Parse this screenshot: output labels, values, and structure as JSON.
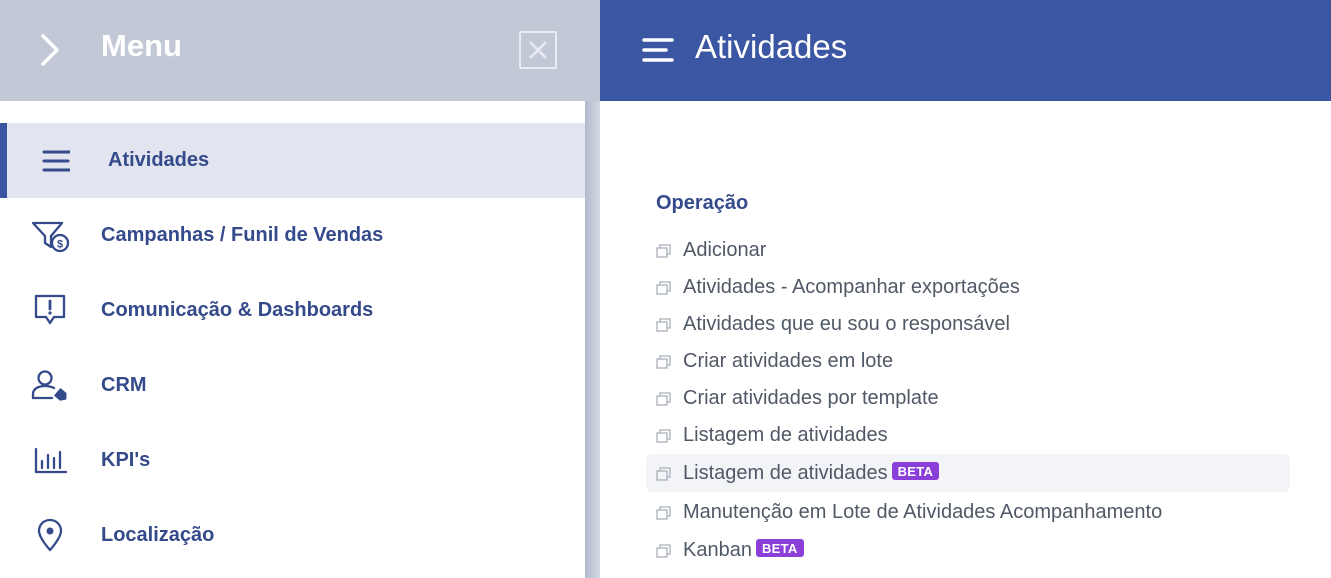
{
  "menu": {
    "title": "Menu",
    "items": [
      {
        "label": "Atividades",
        "icon": "list-lines-icon",
        "active": true
      },
      {
        "label": "Campanhas / Funil de Vendas",
        "icon": "funnel-dollar-icon"
      },
      {
        "label": "Comunicação & Dashboards",
        "icon": "message-alert-icon"
      },
      {
        "label": "CRM",
        "icon": "user-tag-icon"
      },
      {
        "label": "KPI's",
        "icon": "bar-chart-icon"
      },
      {
        "label": "Localização",
        "icon": "map-pin-icon"
      }
    ]
  },
  "content": {
    "title": "Atividades",
    "section": "Operação",
    "links": [
      {
        "label": "Adicionar"
      },
      {
        "label": "Atividades - Acompanhar exportações"
      },
      {
        "label": "Atividades que eu sou o responsável"
      },
      {
        "label": "Criar atividades em lote"
      },
      {
        "label": "Criar atividades por template"
      },
      {
        "label": "Listagem de atividades"
      },
      {
        "label": "Listagem de atividades",
        "badge": "BETA"
      },
      {
        "label": "Manutenção em Lote de Atividades Acompanhamento"
      },
      {
        "label": "Kanban",
        "badge": "BETA"
      }
    ]
  },
  "colors": {
    "menu_header_bg": "#c2c8d6",
    "content_header_bg": "#3b56a2",
    "menu_text": "#344a8a",
    "active_item_bg": "#e2e5ef",
    "beta_badge_bg": "#8b3fd9"
  }
}
